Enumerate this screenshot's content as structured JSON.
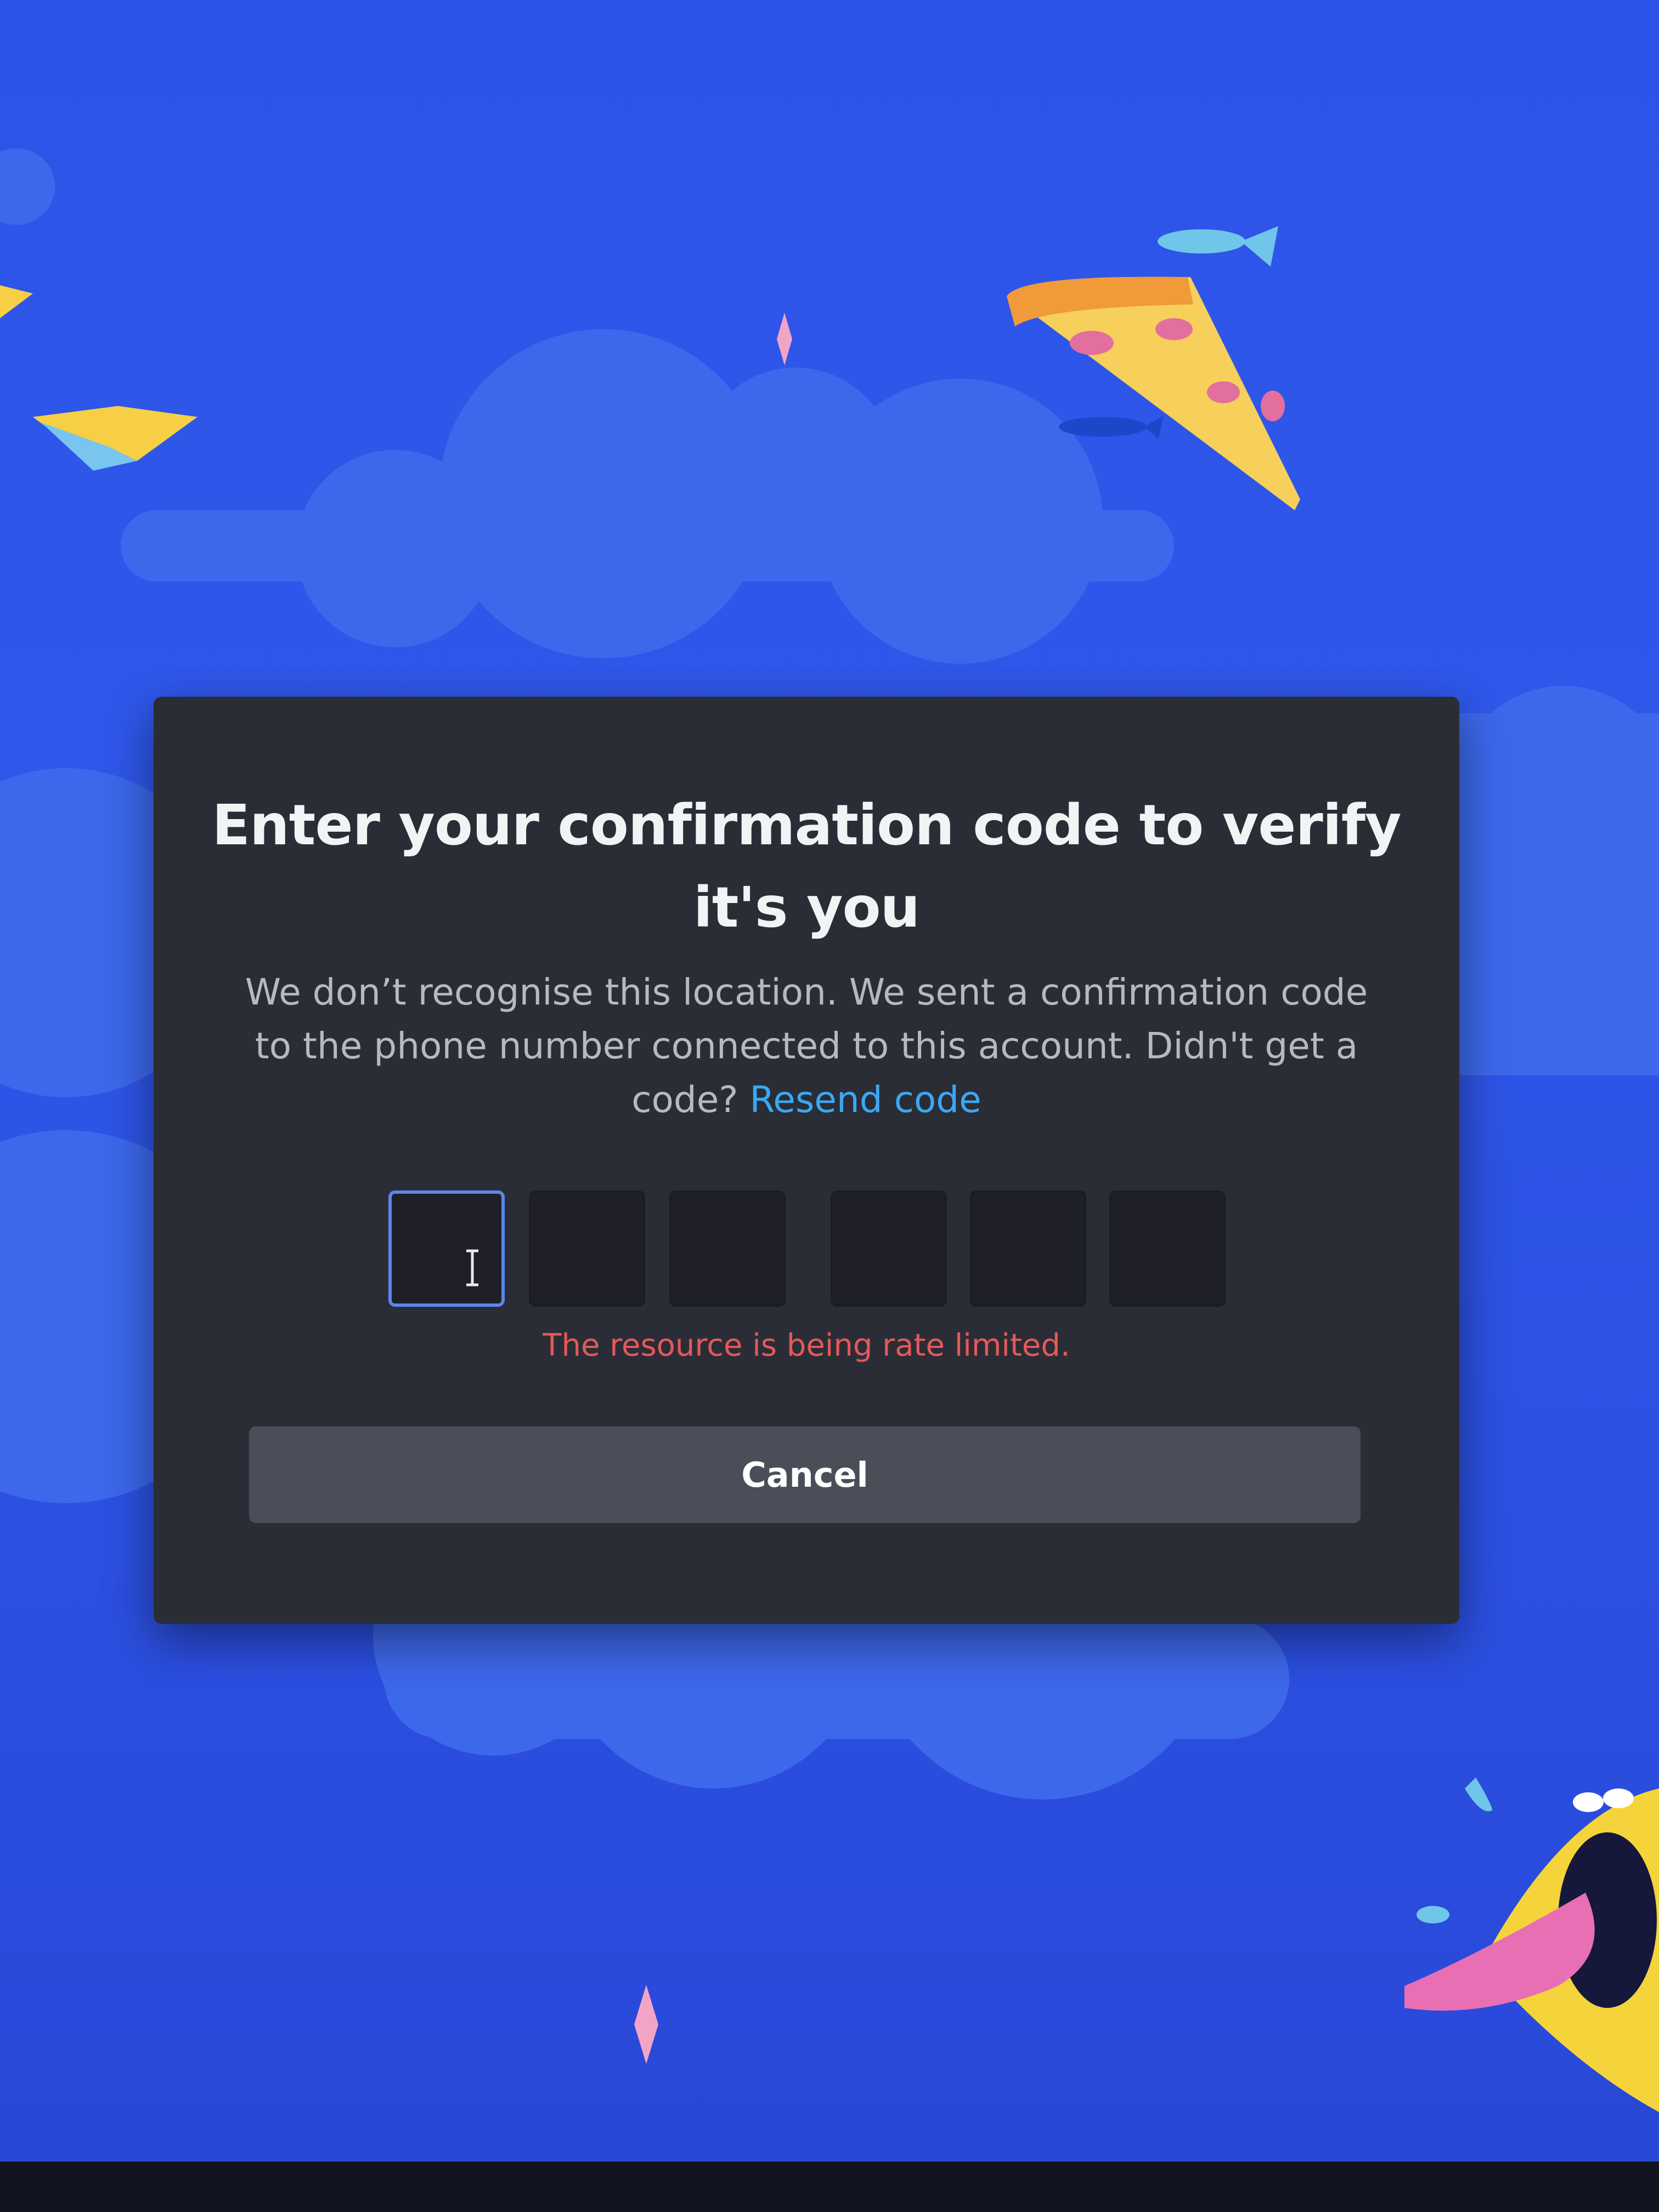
{
  "dialog": {
    "title": "Enter your confirmation code to verify it's you",
    "description_prefix": "We don’t recognise this location. We sent a confirmation code to the phone number connected to this account. Didn't get a code?",
    "resend_label": "Resend code",
    "code_digits": [
      "",
      "",
      "",
      "",
      "",
      ""
    ],
    "error_message": "The resource is being rate limited.",
    "cancel_label": "Cancel"
  },
  "icons": {
    "cursor": "text-cursor-icon"
  },
  "colors": {
    "background": "#2f55e6",
    "modal": "#2b2d36",
    "link": "#3ba8f2",
    "error": "#e4585a",
    "focus_border": "#5b86ec",
    "button": "#4a4e59"
  }
}
